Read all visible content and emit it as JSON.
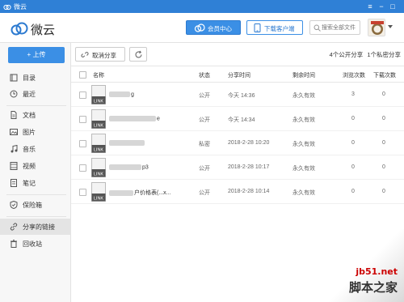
{
  "window": {
    "title": "微云"
  },
  "header": {
    "brand": "微云",
    "vip_label": "会员中心",
    "download_label": "下载客户端",
    "search_placeholder": "搜索全部文件"
  },
  "sidebar": {
    "upload_label": "+ 上传",
    "groups": [
      [
        {
          "label": "目录",
          "icon": "directory-icon"
        },
        {
          "label": "最近",
          "icon": "clock-icon"
        }
      ],
      [
        {
          "label": "文档",
          "icon": "document-icon"
        },
        {
          "label": "图片",
          "icon": "image-icon"
        },
        {
          "label": "音乐",
          "icon": "music-icon"
        },
        {
          "label": "视频",
          "icon": "video-icon"
        },
        {
          "label": "笔记",
          "icon": "note-icon"
        }
      ],
      [
        {
          "label": "保险箱",
          "icon": "shield-icon"
        }
      ],
      [
        {
          "label": "分享的链接",
          "icon": "link-icon",
          "active": true
        },
        {
          "label": "回收站",
          "icon": "trash-icon"
        }
      ]
    ]
  },
  "toolbar": {
    "cancel_share_label": "取消分享",
    "public_count": "4个公开分享",
    "private_count": "1个私密分享"
  },
  "columns": {
    "name": "名称",
    "status": "状态",
    "share_time": "分享时间",
    "remaining": "剩余时间",
    "views": "浏览次数",
    "downloads": "下载次数"
  },
  "rows": [
    {
      "name_visible": "g",
      "status": "公开",
      "share_time": "今天 14:36",
      "remaining": "永久有效",
      "views": "3",
      "downloads": "0"
    },
    {
      "name_visible": "e",
      "status": "公开",
      "share_time": "今天 14:34",
      "remaining": "永久有效",
      "views": "0",
      "downloads": "0"
    },
    {
      "name_visible": "",
      "status": "私密",
      "share_time": "2018-2-28 10:20",
      "remaining": "永久有效",
      "views": "0",
      "downloads": "0"
    },
    {
      "name_visible": "p3",
      "status": "公开",
      "share_time": "2018-2-28 10:17",
      "remaining": "永久有效",
      "views": "0",
      "downloads": "0"
    },
    {
      "name_visible": "户价格表(...x...",
      "status": "公开",
      "share_time": "2018-2-28 10:14",
      "remaining": "永久有效",
      "views": "0",
      "downloads": "0"
    }
  ],
  "thumb_label": "LINK",
  "watermark": {
    "site": "jb51.net",
    "name": "脚本之家"
  },
  "colors": {
    "accent": "#3b8fe5",
    "titlebar": "#2f80d6"
  }
}
